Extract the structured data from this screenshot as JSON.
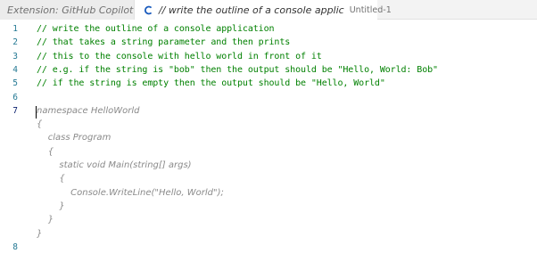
{
  "tabs": {
    "inactive": {
      "label": "Extension: GitHub Copilot"
    },
    "active": {
      "label": "// write the outline of a console applic",
      "description": "Untitled-1"
    }
  },
  "editor": {
    "lines": [
      {
        "number": "1",
        "text": "// write the outline of a console application",
        "kind": "comment"
      },
      {
        "number": "2",
        "text": "// that takes a string parameter and then prints",
        "kind": "comment"
      },
      {
        "number": "3",
        "text": "// this to the console with hello world in front of it",
        "kind": "comment"
      },
      {
        "number": "4",
        "text": "// e.g. if the string is \"bob\" then the output should be \"Hello, World: Bob\"",
        "kind": "comment"
      },
      {
        "number": "5",
        "text": "// if the string is empty then the output should be \"Hello, World\"",
        "kind": "comment"
      },
      {
        "number": "6",
        "text": "",
        "kind": "blank"
      },
      {
        "number": "7",
        "text": "namespace HelloWorld",
        "kind": "ghost"
      },
      {
        "number": "",
        "text": "{",
        "kind": "ghost"
      },
      {
        "number": "",
        "text": "    class Program",
        "kind": "ghost"
      },
      {
        "number": "",
        "text": "    {",
        "kind": "ghost"
      },
      {
        "number": "",
        "text": "        static void Main(string[] args)",
        "kind": "ghost"
      },
      {
        "number": "",
        "text": "        {",
        "kind": "ghost"
      },
      {
        "number": "",
        "text": "            Console.WriteLine(\"Hello, World\");",
        "kind": "ghost"
      },
      {
        "number": "",
        "text": "        }",
        "kind": "ghost"
      },
      {
        "number": "",
        "text": "    }",
        "kind": "ghost"
      },
      {
        "number": "",
        "text": "}",
        "kind": "ghost"
      },
      {
        "number": "8",
        "text": "",
        "kind": "blank"
      }
    ]
  },
  "colors": {
    "comment": "#008000",
    "ghost_text": "#8a8a8a",
    "line_number": "#237893",
    "active_line_number": "#0b216f"
  }
}
